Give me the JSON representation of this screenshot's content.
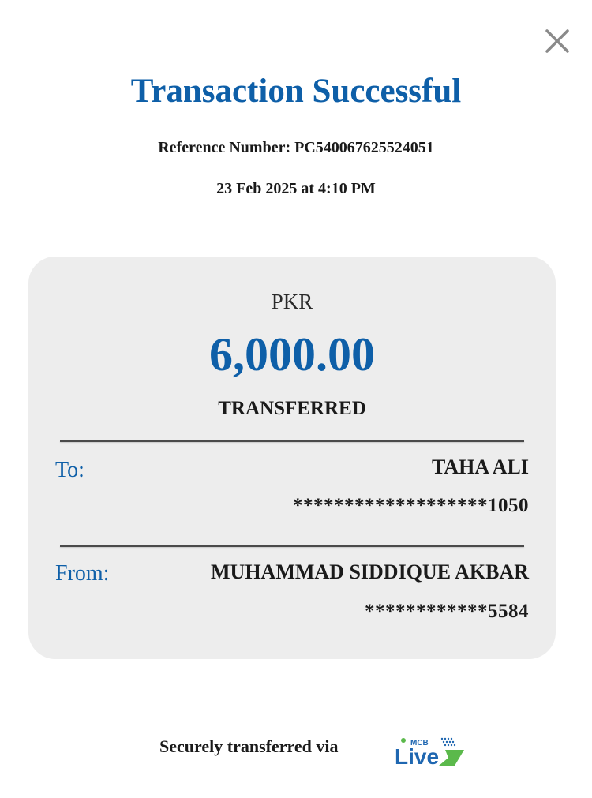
{
  "header": {
    "title": "Transaction Successful",
    "reference": "Reference Number: PC540067625524051",
    "datetime": "23 Feb 2025 at 4:10 PM",
    "close_icon": "close-icon"
  },
  "card": {
    "currency": "PKR",
    "amount": "6,000.00",
    "status": "TRANSFERRED",
    "to": {
      "label": "To:",
      "name": "TAHA ALI",
      "account": "*******************1050"
    },
    "from": {
      "label": "From:",
      "name": "MUHAMMAD SIDDIQUE AKBAR",
      "account": "************5584"
    }
  },
  "footer": {
    "text": "Securely transferred via",
    "logo_small": "MCB",
    "logo_large": "Live"
  },
  "colors": {
    "accent_blue": "#0e5fa8",
    "card_bg": "#ededed",
    "logo_green": "#5bb94b"
  }
}
